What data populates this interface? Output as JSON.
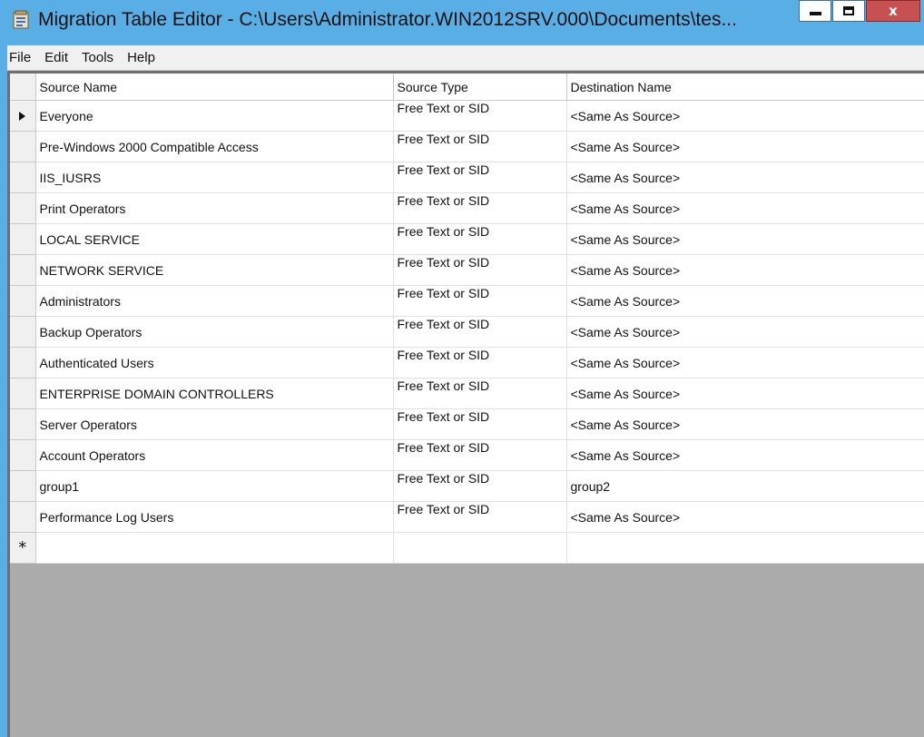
{
  "window": {
    "title": "Migration Table Editor - C:\\Users\\Administrator.WIN2012SRV.000\\Documents\\tes...",
    "close_glyph": "x"
  },
  "menu": {
    "items": [
      "File",
      "Edit",
      "Tools",
      "Help"
    ]
  },
  "grid": {
    "columns": [
      "Source Name",
      "Source Type",
      "Destination Name"
    ],
    "rows": [
      {
        "source_name": "Everyone",
        "source_type": "Free Text or SID",
        "destination_name": "<Same As Source>"
      },
      {
        "source_name": "Pre-Windows 2000 Compatible Access",
        "source_type": "Free Text or SID",
        "destination_name": "<Same As Source>"
      },
      {
        "source_name": "IIS_IUSRS",
        "source_type": "Free Text or SID",
        "destination_name": "<Same As Source>"
      },
      {
        "source_name": "Print Operators",
        "source_type": "Free Text or SID",
        "destination_name": "<Same As Source>"
      },
      {
        "source_name": "LOCAL SERVICE",
        "source_type": "Free Text or SID",
        "destination_name": "<Same As Source>"
      },
      {
        "source_name": "NETWORK SERVICE",
        "source_type": "Free Text or SID",
        "destination_name": "<Same As Source>"
      },
      {
        "source_name": "Administrators",
        "source_type": "Free Text or SID",
        "destination_name": "<Same As Source>"
      },
      {
        "source_name": "Backup Operators",
        "source_type": "Free Text or SID",
        "destination_name": "<Same As Source>"
      },
      {
        "source_name": "Authenticated Users",
        "source_type": "Free Text or SID",
        "destination_name": "<Same As Source>"
      },
      {
        "source_name": "ENTERPRISE DOMAIN CONTROLLERS",
        "source_type": "Free Text or SID",
        "destination_name": "<Same As Source>"
      },
      {
        "source_name": "Server Operators",
        "source_type": "Free Text or SID",
        "destination_name": "<Same As Source>"
      },
      {
        "source_name": "Account Operators",
        "source_type": "Free Text or SID",
        "destination_name": "<Same As Source>"
      },
      {
        "source_name": "group1",
        "source_type": "Free Text or SID",
        "destination_name": "group2"
      },
      {
        "source_name": "Performance Log Users",
        "source_type": "Free Text or SID",
        "destination_name": "<Same As Source>"
      }
    ],
    "current_row_marker": "current-row-arrow-icon",
    "new_row_marker": "*"
  },
  "colors": {
    "title_bar": "#5aaee6",
    "close_button": "#c75050",
    "grid_empty_area": "#ababab"
  }
}
